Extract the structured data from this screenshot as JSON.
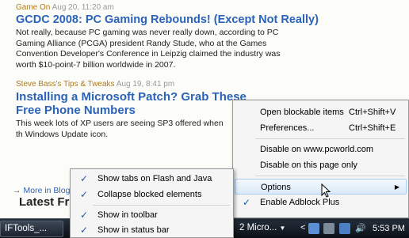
{
  "feed": {
    "entries": [
      {
        "source": "Game On",
        "date": "Aug 20, 11:20 am",
        "headline": "GCDC 2008: PC Gaming Rebounds! (Except Not Really)",
        "blurb": "Not really, because PC gaming was never really down, according to PC Gaming Alliance (PCGA) president Randy Stude, who at the Games Convention Developer's Conference in Leipzig claimed the industry was worth $10-point-7 billion worldwide in 2007."
      },
      {
        "source": "Steve Bass's Tips & Tweaks",
        "date": "Aug 19, 8:41 pm",
        "headline": "Installing a Microsoft Patch? Grab These Free Phone Numbers",
        "blurb": "This week lots of XP users are seeing SP3 offered when th Windows Update icon."
      }
    ],
    "more_link": "More in Blogs",
    "latest_heading": "Latest Fro"
  },
  "context_menu": {
    "items": [
      {
        "label": "Open blockable items",
        "shortcut": "Ctrl+Shift+V"
      },
      {
        "label": "Preferences...",
        "shortcut": "Ctrl+Shift+E"
      },
      {
        "label": "Disable on www.pcworld.com",
        "shortcut": ""
      },
      {
        "label": "Disable on this page only",
        "shortcut": ""
      },
      {
        "label": "Options",
        "shortcut": ""
      },
      {
        "label": "Enable Adblock Plus",
        "shortcut": ""
      }
    ]
  },
  "options_submenu": {
    "items": [
      {
        "label": "Show tabs on Flash and Java"
      },
      {
        "label": "Collapse blocked elements"
      },
      {
        "label": "Show in toolbar"
      },
      {
        "label": "Show in status bar"
      }
    ]
  },
  "taskbar": {
    "left_button": "IFTools_...",
    "right_button": "2 Micro...",
    "clock": "5:53 PM"
  },
  "colors": {
    "link": "#2a63b9",
    "source": "#b07a1a",
    "check": "#1c55b8"
  }
}
